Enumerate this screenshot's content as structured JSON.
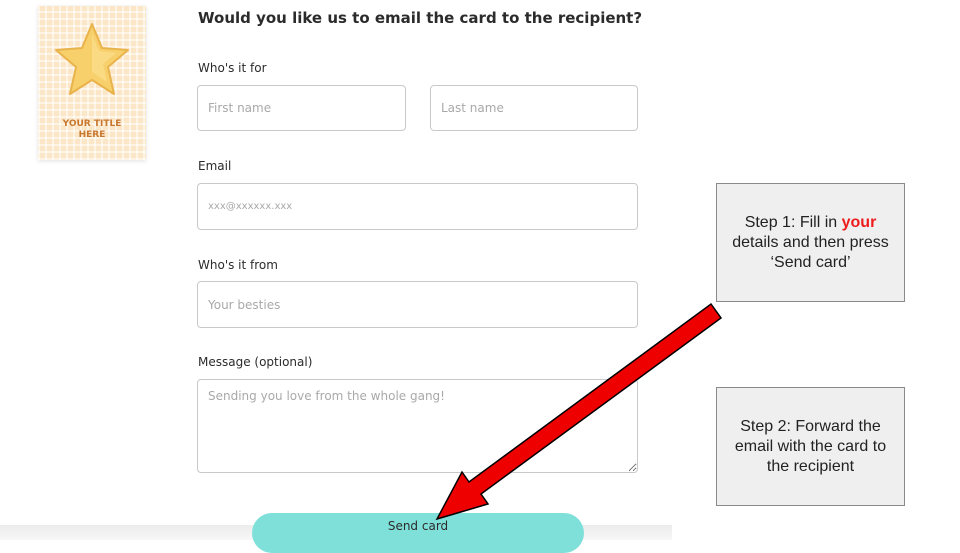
{
  "card": {
    "title_line1": "YOUR TITLE",
    "title_line2": "HERE"
  },
  "form": {
    "heading": "Would you like us to email the card to the recipient?",
    "recipient": {
      "label": "Who's it for",
      "first_name_placeholder": "First name",
      "last_name_placeholder": "Last name"
    },
    "email": {
      "label": "Email",
      "placeholder": "xxx@xxxxxx.xxx"
    },
    "sender": {
      "label": "Who's it from",
      "placeholder": "Your besties"
    },
    "message": {
      "label": "Message (optional)",
      "placeholder": "Sending you love from the whole gang!"
    },
    "send_label": "Send card"
  },
  "annotations": {
    "step1": {
      "before": "Step 1: Fill in ",
      "highlight": "your",
      "after": " details and then press ‘Send card’"
    },
    "step2": {
      "text": "Step 2: Forward the email with the card to the recipient"
    },
    "arrow_color": "#ee0000",
    "highlight_color": "#ee1c1c"
  }
}
